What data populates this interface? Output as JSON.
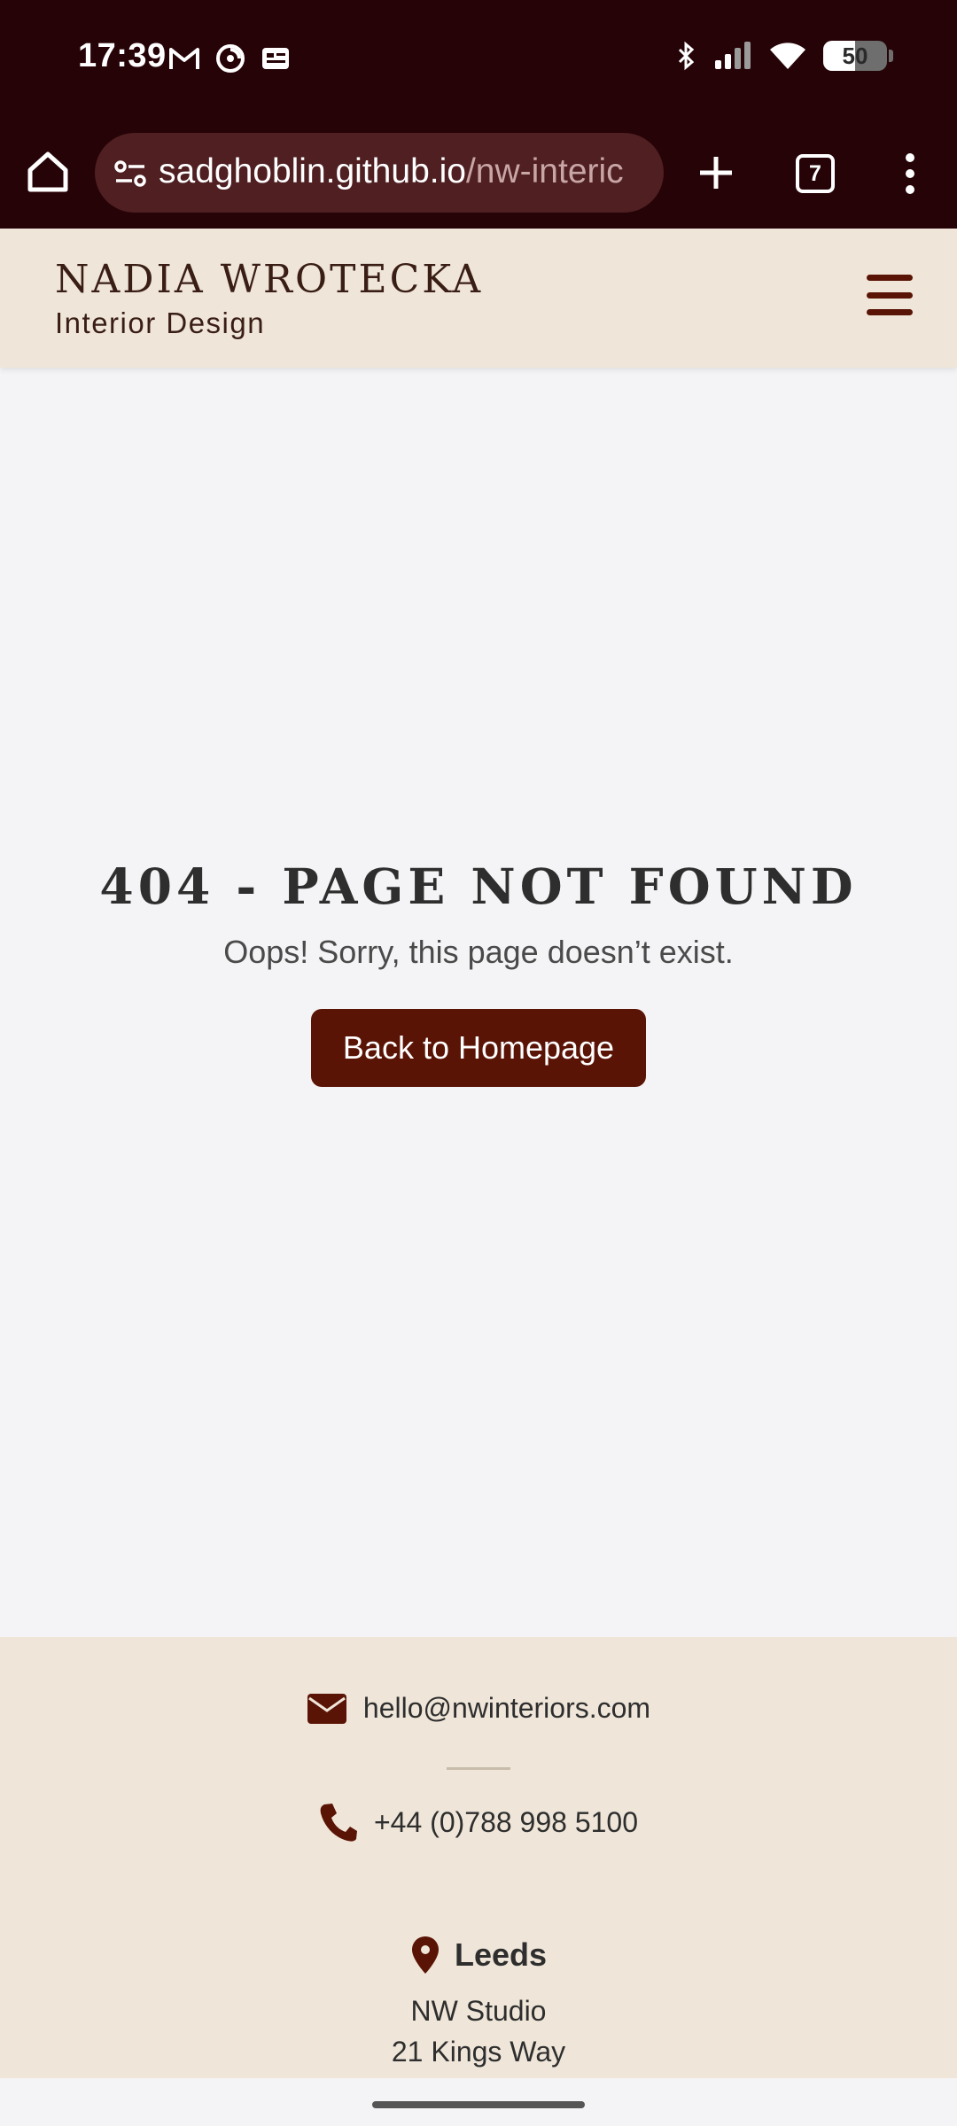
{
  "status_bar": {
    "time": "17:39",
    "left_icons": [
      "gmail-icon",
      "sync-app-icon",
      "news-app-icon"
    ],
    "right_icons": [
      "bluetooth-icon",
      "signal-icon",
      "wifi-icon"
    ],
    "battery": "50"
  },
  "browser": {
    "url_host": "sadghoblin.github.io",
    "url_path": "/nw-interic",
    "tab_count": "7",
    "icons": [
      "home-icon",
      "site-settings-icon",
      "plus-icon",
      "tabs-icon",
      "more-vert-icon"
    ]
  },
  "site_header": {
    "brand_name": "NADIA WROTECKA",
    "tagline": "Interior Design",
    "menu_icon": "hamburger-icon"
  },
  "main": {
    "title": "404 - PAGE NOT FOUND",
    "message": "Oops! Sorry, this page doesn’t exist.",
    "button_label": "Back to Homepage"
  },
  "footer": {
    "email": "hello@nwinteriors.com",
    "phone": "+44 (0)788 998 5100",
    "city": "Leeds",
    "studio": "NW Studio",
    "street": "21 Kings Way",
    "icons": [
      "envelope-icon",
      "phone-icon",
      "location-pin-icon"
    ]
  },
  "colors": {
    "browser_chrome": "#260307",
    "accent": "#5a1406",
    "header_bg": "#efe6d9",
    "page_bg": "#f4f4f6"
  }
}
